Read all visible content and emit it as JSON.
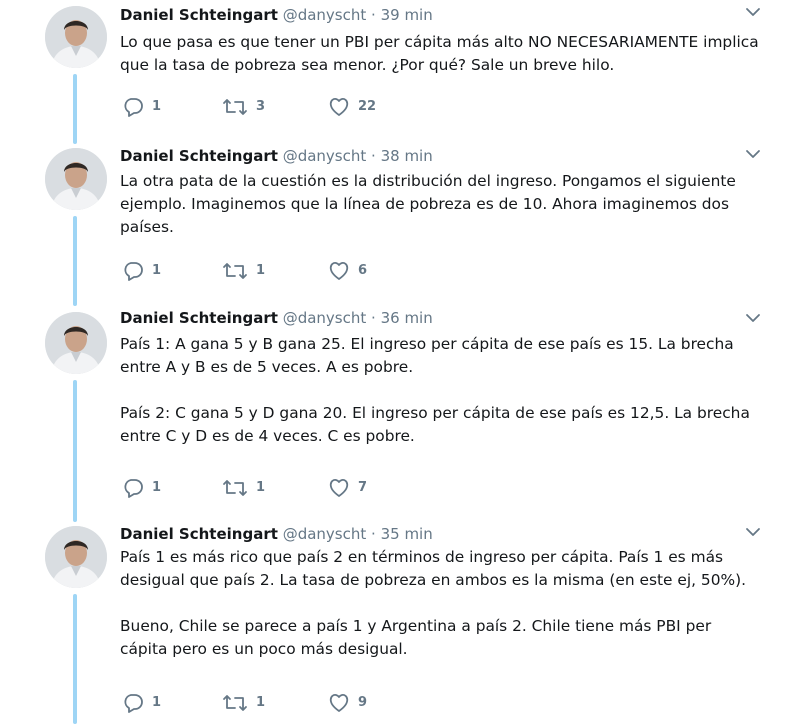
{
  "tweets": [
    {
      "author": "Daniel Schteingart",
      "handle": "@danyscht",
      "dot": "·",
      "time": "39 min",
      "text": "Lo que pasa es que tener un PBI per cápita más alto NO NECESARIAMENTE implica que la tasa de pobreza sea menor. ¿Por qué? Sale un breve hilo.",
      "replies": "1",
      "retweets": "3",
      "likes": "22"
    },
    {
      "author": "Daniel Schteingart",
      "handle": "@danyscht",
      "dot": "·",
      "time": "38 min",
      "text": "La otra pata de la cuestión es la distribución del ingreso. Pongamos el siguiente ejemplo. Imaginemos que la línea de pobreza es de 10. Ahora imaginemos dos países.",
      "replies": "1",
      "retweets": "1",
      "likes": "6"
    },
    {
      "author": "Daniel Schteingart",
      "handle": "@danyscht",
      "dot": "·",
      "time": "36 min",
      "text": "País 1: A gana 5 y B gana 25. El ingreso per cápita de ese país es 15. La brecha entre A y B es de 5 veces. A es pobre.\n\nPaís 2: C gana 5 y D gana 20. El ingreso per cápita de ese país es 12,5. La brecha entre C y D es de 4 veces. C es pobre.",
      "replies": "1",
      "retweets": "1",
      "likes": "7"
    },
    {
      "author": "Daniel Schteingart",
      "handle": "@danyscht",
      "dot": "·",
      "time": "35 min",
      "text": "País 1 es más rico que país 2 en términos de ingreso per cápita. País 1 es más desigual que país 2. La tasa de pobreza en ambos es la misma (en este ej, 50%).\n\nBueno, Chile se parece a país 1 y Argentina a país 2. Chile tiene más PBI per cápita pero es un poco más desigual.",
      "replies": "1",
      "retweets": "1",
      "likes": "9"
    }
  ],
  "icons": {
    "reply": "reply-icon",
    "retweet": "retweet-icon",
    "like": "heart-icon",
    "caret": "chevron-down-icon",
    "avatar": "avatar"
  },
  "colors": {
    "author": "#14171a",
    "muted": "#657786",
    "thread_line": "#9ed5f5"
  }
}
